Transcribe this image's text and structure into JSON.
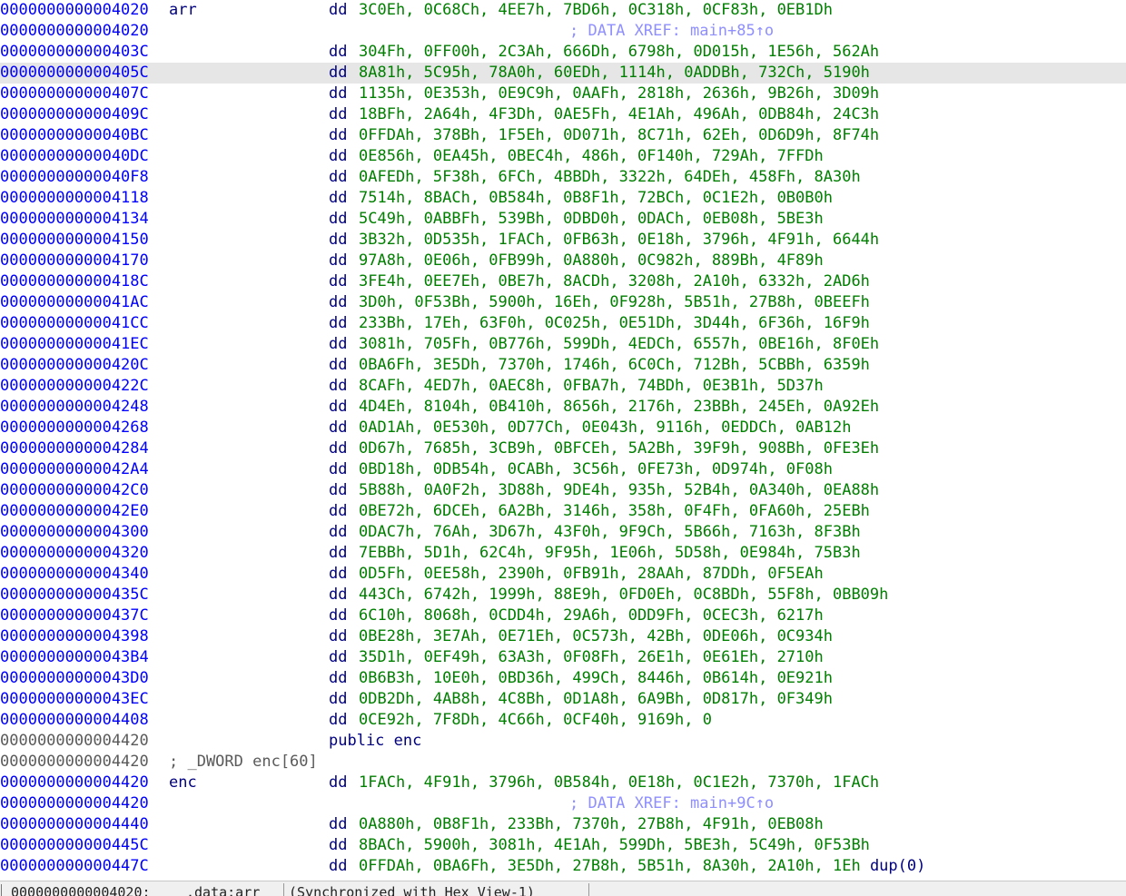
{
  "rows": [
    {
      "addr": "0000000000004020",
      "label": "arr",
      "mn": "dd",
      "ops": "3C0Eh, 0C68Ch, 4EE7h, 7BD6h, 0C318h, 0CF83h, 0EB1Dh"
    },
    {
      "addr": "0000000000004020",
      "xref": "; DATA XREF: main+85↑o"
    },
    {
      "addr": "000000000000403C",
      "mn": "dd",
      "ops": "304Fh, 0FF00h, 2C3Ah, 666Dh, 6798h, 0D015h, 1E56h, 562Ah"
    },
    {
      "addr": "000000000000405C",
      "mn": "dd",
      "ops": "8A81h, 5C95h, 78A0h, 60EDh, 1114h, 0ADDBh, 732Ch, 5190h",
      "selected": true
    },
    {
      "addr": "000000000000407C",
      "mn": "dd",
      "ops": "1135h, 0E353h, 0E9C9h, 0AAFh, 2818h, 2636h, 9B26h, 3D09h"
    },
    {
      "addr": "000000000000409C",
      "mn": "dd",
      "ops": "18BFh, 2A64h, 4F3Dh, 0AE5Fh, 4E1Ah, 496Ah, 0DB84h, 24C3h"
    },
    {
      "addr": "00000000000040BC",
      "mn": "dd",
      "ops": "0FFDAh, 378Bh, 1F5Eh, 0D071h, 8C71h, 62Eh, 0D6D9h, 8F74h"
    },
    {
      "addr": "00000000000040DC",
      "mn": "dd",
      "ops": "0E856h, 0EA45h, 0BEC4h, 486h, 0F140h, 729Ah, 7FFDh"
    },
    {
      "addr": "00000000000040F8",
      "mn": "dd",
      "ops": "0AFEDh, 5F38h, 6FCh, 4BBDh, 3322h, 64DEh, 458Fh, 8A30h"
    },
    {
      "addr": "0000000000004118",
      "mn": "dd",
      "ops": "7514h, 8BACh, 0B584h, 0B8F1h, 72BCh, 0C1E2h, 0B0B0h"
    },
    {
      "addr": "0000000000004134",
      "mn": "dd",
      "ops": "5C49h, 0ABBFh, 539Bh, 0DBD0h, 0DACh, 0EB08h, 5BE3h"
    },
    {
      "addr": "0000000000004150",
      "mn": "dd",
      "ops": "3B32h, 0D535h, 1FACh, 0FB63h, 0E18h, 3796h, 4F91h, 6644h"
    },
    {
      "addr": "0000000000004170",
      "mn": "dd",
      "ops": "97A8h, 0E06h, 0FB99h, 0A880h, 0C982h, 889Bh, 4F89h"
    },
    {
      "addr": "000000000000418C",
      "mn": "dd",
      "ops": "3FE4h, 0EE7Eh, 0BE7h, 8ACDh, 3208h, 2A10h, 6332h, 2AD6h"
    },
    {
      "addr": "00000000000041AC",
      "mn": "dd",
      "ops": "3D0h, 0F53Bh, 5900h, 16Eh, 0F928h, 5B51h, 27B8h, 0BEEFh"
    },
    {
      "addr": "00000000000041CC",
      "mn": "dd",
      "ops": "233Bh, 17Eh, 63F0h, 0C025h, 0E51Dh, 3D44h, 6F36h, 16F9h"
    },
    {
      "addr": "00000000000041EC",
      "mn": "dd",
      "ops": "3081h, 705Fh, 0B776h, 599Dh, 4EDCh, 6557h, 0BE16h, 8F0Eh"
    },
    {
      "addr": "000000000000420C",
      "mn": "dd",
      "ops": "0BA6Fh, 3E5Dh, 7370h, 1746h, 6C0Ch, 712Bh, 5CBBh, 6359h"
    },
    {
      "addr": "000000000000422C",
      "mn": "dd",
      "ops": "8CAFh, 4ED7h, 0AEC8h, 0FBA7h, 74BDh, 0E3B1h, 5D37h"
    },
    {
      "addr": "0000000000004248",
      "mn": "dd",
      "ops": "4D4Eh, 8104h, 0B410h, 8656h, 2176h, 23BBh, 245Eh, 0A92Eh"
    },
    {
      "addr": "0000000000004268",
      "mn": "dd",
      "ops": "0AD1Ah, 0E530h, 0D77Ch, 0E043h, 9116h, 0EDDCh, 0AB12h"
    },
    {
      "addr": "0000000000004284",
      "mn": "dd",
      "ops": "0D67h, 7685h, 3CB9h, 0BFCEh, 5A2Bh, 39F9h, 908Bh, 0FE3Eh"
    },
    {
      "addr": "00000000000042A4",
      "mn": "dd",
      "ops": "0BD18h, 0DB54h, 0CABh, 3C56h, 0FE73h, 0D974h, 0F08h"
    },
    {
      "addr": "00000000000042C0",
      "mn": "dd",
      "ops": "5B88h, 0A0F2h, 3D88h, 9DE4h, 935h, 52B4h, 0A340h, 0EA88h"
    },
    {
      "addr": "00000000000042E0",
      "mn": "dd",
      "ops": "0BE72h, 6DCEh, 6A2Bh, 3146h, 358h, 0F4Fh, 0FA60h, 25EBh"
    },
    {
      "addr": "0000000000004300",
      "mn": "dd",
      "ops": "0DAC7h, 76Ah, 3D67h, 43F0h, 9F9Ch, 5B66h, 7163h, 8F3Bh"
    },
    {
      "addr": "0000000000004320",
      "mn": "dd",
      "ops": "7EBBh, 5D1h, 62C4h, 9F95h, 1E06h, 5D58h, 0E984h, 75B3h"
    },
    {
      "addr": "0000000000004340",
      "mn": "dd",
      "ops": "0D5Fh, 0EE58h, 2390h, 0FB91h, 28AAh, 87DDh, 0F5EAh"
    },
    {
      "addr": "000000000000435C",
      "mn": "dd",
      "ops": "443Ch, 6742h, 1999h, 88E9h, 0FD0Eh, 0C8BDh, 55F8h, 0BB09h"
    },
    {
      "addr": "000000000000437C",
      "mn": "dd",
      "ops": "6C10h, 8068h, 0CDD4h, 29A6h, 0DD9Fh, 0CEC3h, 6217h"
    },
    {
      "addr": "0000000000004398",
      "mn": "dd",
      "ops": "0BE28h, 3E7Ah, 0E71Eh, 0C573h, 42Bh, 0DE06h, 0C934h"
    },
    {
      "addr": "00000000000043B4",
      "mn": "dd",
      "ops": "35D1h, 0EF49h, 63A3h, 0F08Fh, 26E1h, 0E61Eh, 2710h"
    },
    {
      "addr": "00000000000043D0",
      "mn": "dd",
      "ops": "0B6B3h, 10E0h, 0BD36h, 499Ch, 8446h, 0B614h, 0E921h"
    },
    {
      "addr": "00000000000043EC",
      "mn": "dd",
      "ops": "0DB2Dh, 4AB8h, 4C8Bh, 0D1A8h, 6A9Bh, 0D817h, 0F349h"
    },
    {
      "addr": "0000000000004408",
      "mn": "dd",
      "ops": "0CE92h, 7F8Dh, 4C66h, 0CF40h, 9169h, 0"
    },
    {
      "addr": "0000000000004420",
      "gray": true,
      "public": "public enc"
    },
    {
      "addr": "0000000000004420",
      "gray": true,
      "comment": "; _DWORD enc[60]"
    },
    {
      "addr": "0000000000004420",
      "label": "enc",
      "mn": "dd",
      "ops": "1FACh, 4F91h, 3796h, 0B584h, 0E18h, 0C1E2h, 7370h, 1FACh"
    },
    {
      "addr": "0000000000004420",
      "xref": "; DATA XREF: main+9C↑o"
    },
    {
      "addr": "0000000000004440",
      "mn": "dd",
      "ops": "0A880h, 0B8F1h, 233Bh, 7370h, 27B8h, 4F91h, 0EB08h"
    },
    {
      "addr": "000000000000445C",
      "mn": "dd",
      "ops": "8BACh, 5900h, 3081h, 4E1Ah, 599Dh, 5BE3h, 5C49h, 0F53Bh"
    },
    {
      "addr": "000000000000447C",
      "mn": "dd",
      "ops": "0FFDAh, 0BA6Fh, 3E5Dh, 27B8h, 5B51h, 8A30h, 2A10h, 1Eh",
      "dup": "dup(0)"
    }
  ],
  "status": {
    "address": "0000000000004020:",
    "location": ".data:arr",
    "sync": "(Synchronized with Hex View-1)"
  },
  "colors": {
    "address": "#0000ff",
    "label": "#00007f",
    "operand": "#007f00",
    "xref": "#8f8fff",
    "selection": "#e6e6e6"
  }
}
